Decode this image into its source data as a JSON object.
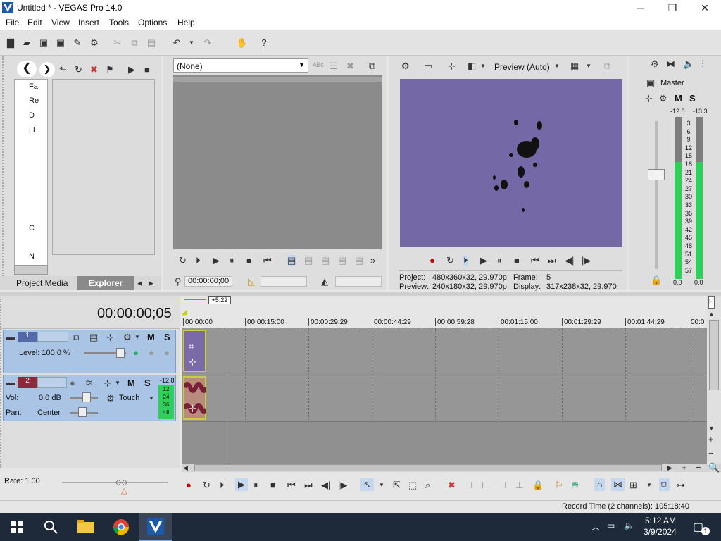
{
  "window": {
    "title": "Untitled * - VEGAS Pro 14.0",
    "min": "─",
    "max": "❐",
    "close": "✕"
  },
  "menu": [
    "File",
    "Edit",
    "View",
    "Insert",
    "Tools",
    "Options",
    "Help"
  ],
  "trimmer": {
    "select_value": "(None)",
    "timecode": "00:00:00;00"
  },
  "preview": {
    "mode": "Preview (Auto)",
    "project_label": "Project:",
    "project_value": "480x360x32, 29.970p",
    "preview_label": "Preview:",
    "preview_value": "240x180x32, 29.970p",
    "frame_label": "Frame:",
    "frame_value": "5",
    "display_label": "Display:",
    "display_value": "317x238x32, 29.970"
  },
  "master": {
    "title": "Master",
    "m": "M",
    "s": "S",
    "peak_left": "-12.8",
    "peak_right": "-13.3",
    "scale": [
      "3",
      "6",
      "9",
      "12",
      "15",
      "18",
      "21",
      "24",
      "27",
      "30",
      "33",
      "36",
      "39",
      "42",
      "45",
      "48",
      "51",
      "54",
      "57"
    ],
    "bottom_left": "0.0",
    "bottom_right": "0.0"
  },
  "explorer": {
    "tabs": [
      "Project Media",
      "Explorer"
    ],
    "tree_items": [
      "Fa",
      "Re",
      "D",
      "Li",
      "C",
      "N"
    ]
  },
  "timeline": {
    "timecode": "00:00:00;05",
    "marker_badge": "+5:22",
    "ruler": [
      "00:00:00",
      "00:00:15:00",
      "00:00:29:29",
      "00:00:44:29",
      "00:00:59:28",
      "00:01:15:00",
      "00:01:29:29",
      "00:01:44:29",
      "00:0"
    ]
  },
  "track1": {
    "number": "1",
    "m": "M",
    "s": "S",
    "level_label": "Level: 100.0 %"
  },
  "track2": {
    "number": "2",
    "m": "M",
    "s": "S",
    "vol_label": "Vol:",
    "vol_value": "0.0 dB",
    "pan_label": "Pan:",
    "pan_value": "Center",
    "automation": "Touch",
    "meter_peak": "-12.8",
    "meter_scale": [
      "12",
      "24",
      "36",
      "48"
    ]
  },
  "bottom": {
    "rate": "Rate: 1.00",
    "record_time": "Record Time (2 channels): 105:18:40"
  },
  "taskbar": {
    "time": "5:12 AM",
    "date": "3/9/2024",
    "notif_count": "1"
  },
  "colors": {
    "preview": "#7468a7",
    "track_header": "#a9c4e4",
    "meter_green": "#2fd05a",
    "taskbar": "#1e2a3a"
  }
}
